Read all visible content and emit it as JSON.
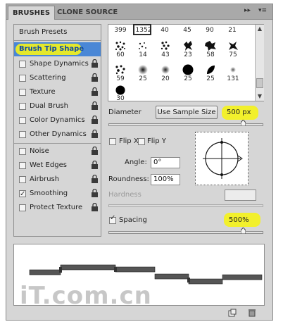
{
  "tabs": [
    {
      "label": "BRUSHES"
    },
    {
      "label": "CLONE SOURCE"
    }
  ],
  "menu": {
    "collapse_glyph": "▸▸",
    "menu_glyph": "▾≡"
  },
  "left_list": {
    "presets_label": "Brush Presets",
    "selected_label": "Brush Tip Shape",
    "items": [
      {
        "label": "Shape Dynamics",
        "checked": false
      },
      {
        "label": "Scattering",
        "checked": false
      },
      {
        "label": "Texture",
        "checked": false
      },
      {
        "label": "Dual Brush",
        "checked": false
      },
      {
        "label": "Color Dynamics",
        "checked": false
      },
      {
        "label": "Other Dynamics",
        "checked": false
      },
      {
        "label": "Noise",
        "checked": false
      },
      {
        "label": "Wet Edges",
        "checked": false
      },
      {
        "label": "Airbrush",
        "checked": false
      },
      {
        "label": "Smoothing",
        "checked": true
      },
      {
        "label": "Protect Texture",
        "checked": false
      }
    ]
  },
  "brush_grid": {
    "top_row": [
      "399",
      "1352",
      "40",
      "45",
      "90",
      "21"
    ],
    "row2": [
      "60",
      "14",
      "43",
      "23",
      "58",
      "75"
    ],
    "row3": [
      "59",
      "25",
      "20",
      "25",
      "25",
      "131"
    ],
    "row4": [
      "30"
    ]
  },
  "diameter": {
    "label": "Diameter",
    "button": "Use Sample Size",
    "value": "500 px"
  },
  "flip": {
    "x_label": "Flip X",
    "y_label": "Flip Y"
  },
  "angle": {
    "label": "Angle:",
    "value": "0°"
  },
  "roundness": {
    "label": "Roundness:",
    "value": "100%"
  },
  "hardness": {
    "label": "Hardness"
  },
  "spacing": {
    "label": "Spacing",
    "value": "500%",
    "checked": true
  },
  "watermark": "iT.com.cn",
  "colors": {
    "highlight": "#f5f31a",
    "selection": "#4a87d6"
  }
}
